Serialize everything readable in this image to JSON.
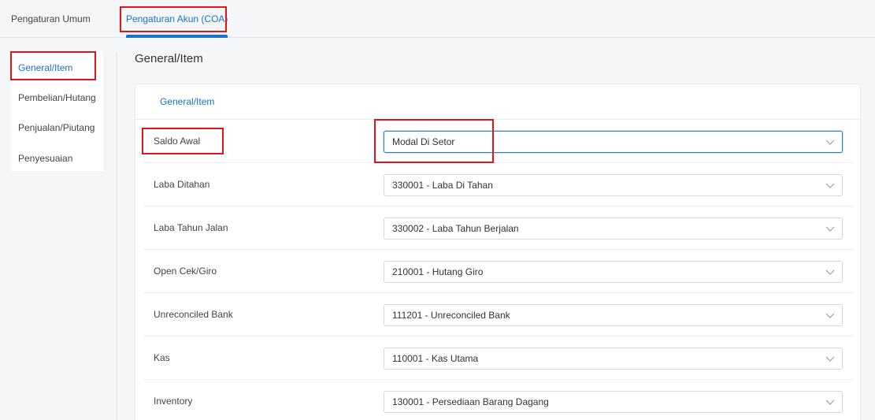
{
  "top_tabs": {
    "general": "Pengaturan Umum",
    "coa": "Pengaturan Akun (COA)"
  },
  "sidebar": {
    "items": [
      {
        "label": "General/Item"
      },
      {
        "label": "Pembelian/Hutang"
      },
      {
        "label": "Penjualan/Piutang"
      },
      {
        "label": "Penyesuaian"
      }
    ]
  },
  "page": {
    "title": "General/Item",
    "card_tab": "General/Item"
  },
  "rows": [
    {
      "label": "Saldo Awal",
      "value": "Modal Di Setor"
    },
    {
      "label": "Laba Ditahan",
      "value": "330001 - Laba Di Tahan"
    },
    {
      "label": "Laba Tahun Jalan",
      "value": "330002 - Laba Tahun Berjalan"
    },
    {
      "label": "Open Cek/Giro",
      "value": "210001 - Hutang Giro"
    },
    {
      "label": "Unreconciled Bank",
      "value": "111201 - Unreconciled Bank"
    },
    {
      "label": "Kas",
      "value": "110001 - Kas Utama"
    },
    {
      "label": "Inventory",
      "value": "130001 - Persediaan Barang Dagang"
    }
  ],
  "colors": {
    "accent": "#1a73c9",
    "highlight": "#e0141b"
  },
  "icons": {
    "dropdown": "chevron-down-icon"
  }
}
